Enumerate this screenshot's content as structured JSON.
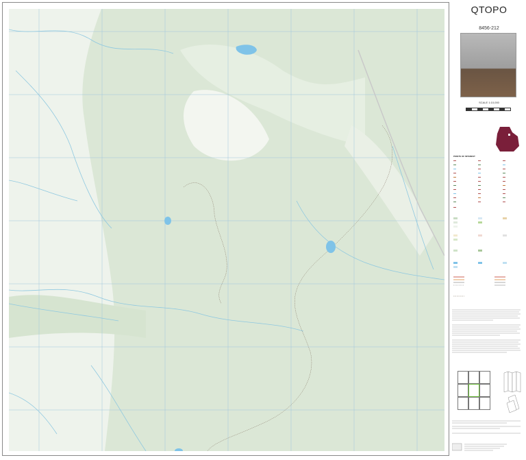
{
  "map": {
    "title": "QTOPO",
    "sheet_number": "8456-212",
    "scale": "SCALE 1:10,000",
    "colors": {
      "vegetation": "#dfe9dc",
      "woodland_dense": "#cfdfcb",
      "water": "#7fc3e8",
      "creek": "#8ec8e0",
      "boundary": "#8a7a6a",
      "road": "#c9c9c9",
      "grid": "#9ec5dc"
    },
    "sections": {
      "legend_title": "POINTS OF INTEREST",
      "disclaimer_head": "QTopo",
      "index_title": "MAP INDEX",
      "print_note": "THIS MAP MAY BE PRINTED OR REPRODUCED BY ANYONE FOR ANY PURPOSE"
    }
  }
}
